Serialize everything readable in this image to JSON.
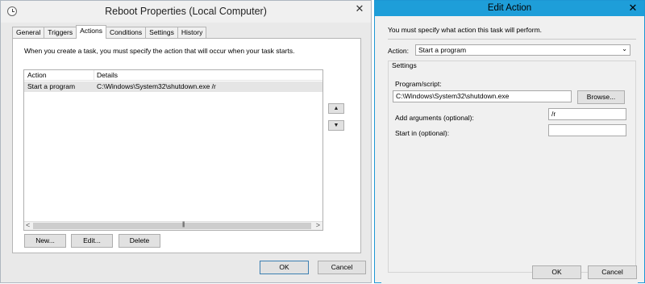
{
  "properties_window": {
    "title": "Reboot Properties (Local Computer)",
    "close_glyph": "✕",
    "tabs": [
      {
        "label": "General"
      },
      {
        "label": "Triggers"
      },
      {
        "label": "Actions",
        "active": true
      },
      {
        "label": "Conditions"
      },
      {
        "label": "Settings"
      },
      {
        "label": "History"
      }
    ],
    "instruction": "When you create a task, you must specify the action that will occur when your task starts.",
    "list": {
      "columns": [
        "Action",
        "Details"
      ],
      "rows": [
        {
          "action": "Start a program",
          "details": "C:\\Windows\\System32\\shutdown.exe /r"
        }
      ]
    },
    "buttons": {
      "new": "New...",
      "edit": "Edit...",
      "delete": "Delete",
      "ok": "OK",
      "cancel": "Cancel"
    }
  },
  "edit_action_dialog": {
    "title": "Edit Action",
    "close_glyph": "✕",
    "must_specify": "You must specify what action this task will perform.",
    "action_label": "Action:",
    "action_value": "Start a program",
    "settings_label": "Settings",
    "program_label": "Program/script:",
    "program_value": "C:\\Windows\\System32\\shutdown.exe",
    "browse_label": "Browse...",
    "args_label": "Add arguments (optional):",
    "args_value": "/r",
    "start_in_label": "Start in (optional):",
    "start_in_value": "",
    "ok_label": "OK",
    "cancel_label": "Cancel"
  },
  "colors": {
    "accent_titlebar": "#1e9ed9",
    "selected_row": "#e5e5e5"
  }
}
